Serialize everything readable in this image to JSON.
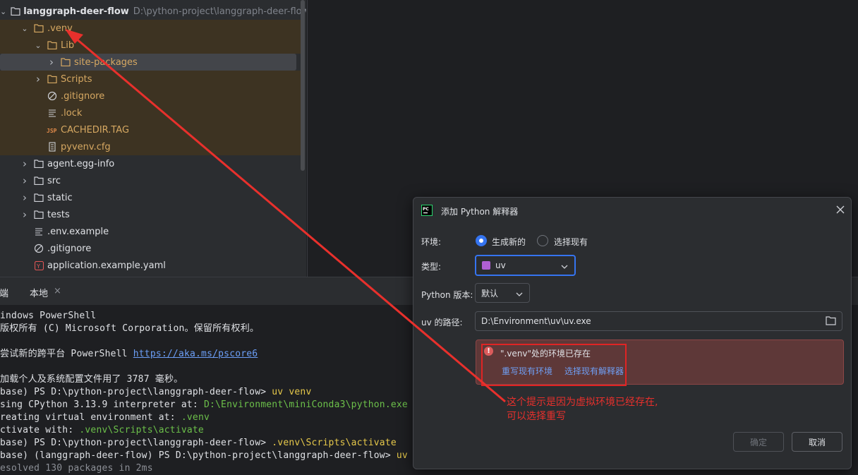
{
  "tree": {
    "root": {
      "name": "langgraph-deer-flow",
      "path": "D:\\python-project\\langgraph-deer-flow"
    },
    "items": [
      {
        "label": ".venv",
        "chevron": "open",
        "icon": "folder-icon",
        "excluded": true
      },
      {
        "label": "Lib",
        "chevron": "open",
        "icon": "folder-icon",
        "excluded": true
      },
      {
        "label": "site-packages",
        "chevron": "closed",
        "icon": "folder-icon",
        "excluded": true,
        "selected": true
      },
      {
        "label": "Scripts",
        "chevron": "closed",
        "icon": "folder-icon",
        "excluded": true
      },
      {
        "label": ".gitignore",
        "chevron": "none",
        "icon": "ignore-file-icon",
        "excluded": true
      },
      {
        "label": ".lock",
        "chevron": "none",
        "icon": "text-file-icon",
        "excluded": true
      },
      {
        "label": "CACHEDIR.TAG",
        "chevron": "none",
        "icon": "jsp-file-icon",
        "excluded": true
      },
      {
        "label": "pyvenv.cfg",
        "chevron": "none",
        "icon": "config-file-icon",
        "excluded": true
      },
      {
        "label": "agent.egg-info",
        "chevron": "closed",
        "icon": "folder-icon",
        "excluded": false
      },
      {
        "label": "src",
        "chevron": "closed",
        "icon": "folder-icon",
        "excluded": false
      },
      {
        "label": "static",
        "chevron": "closed",
        "icon": "folder-icon",
        "excluded": false
      },
      {
        "label": "tests",
        "chevron": "closed",
        "icon": "folder-icon",
        "excluded": false
      },
      {
        "label": ".env.example",
        "chevron": "none",
        "icon": "text-file-icon",
        "excluded": false
      },
      {
        "label": ".gitignore",
        "chevron": "none",
        "icon": "ignore-file-icon",
        "excluded": false
      },
      {
        "label": "application.example.yaml",
        "chevron": "none",
        "icon": "yaml-file-icon",
        "excluded": false
      }
    ]
  },
  "terminal": {
    "tabs": [
      {
        "label": "终端"
      },
      {
        "label": "本地"
      }
    ],
    "close_glyph": "×",
    "lines": [
      "indows PowerShell",
      "版权所有 (C) Microsoft Corporation。保留所有权利。",
      "",
      "尝试新的跨平台 PowerShell ",
      "",
      "加载个人及系统配置文件用了 3787 毫秒。",
      "base) PS D:\\python-project\\langgraph-deer-flow> ",
      "sing CPython 3.13.9 interpreter at: ",
      "reating virtual environment at: ",
      "ctivate with: ",
      "base) PS D:\\python-project\\langgraph-deer-flow> ",
      "base) (langgraph-deer-flow) PS D:\\python-project\\langgraph-deer-flow> ",
      "esolved 130 packages in 2ms"
    ],
    "link": "https://aka.ms/pscore6",
    "cmd_uv_venv": "uv venv",
    "python_path": "D:\\Environment\\miniConda3\\python.exe",
    "venv_dir": ".venv",
    "activate_path": ".venv\\Scripts\\activate",
    "cmd_activate": ".venv\\Scripts\\activate",
    "cmd_uv": "uv"
  },
  "dialog": {
    "title": "添加 Python 解释器",
    "env_label": "环境:",
    "radio_new": "生成新的",
    "radio_existing": "选择现有",
    "type_label": "类型:",
    "type_value": "uv",
    "version_label": "Python 版本:",
    "version_value": "默认",
    "uv_path_label": "uv 的路径:",
    "uv_path_value": "D:\\Environment\\uv\\uv.exe",
    "error_message": "\".venv\"处的环境已存在",
    "link_overwrite": "重写现有环境",
    "link_select": "选择现有解释器",
    "ok_button": "确定",
    "cancel_button": "取消"
  },
  "annotation": {
    "line1": "这个提示是因为虚拟环境已经存在,",
    "line2": "可以选择重写"
  },
  "colors": {
    "accent": "#3574f0",
    "annotation": "#e8302c",
    "error_bg": "#5e3838",
    "excluded_text": "#d6a862"
  }
}
